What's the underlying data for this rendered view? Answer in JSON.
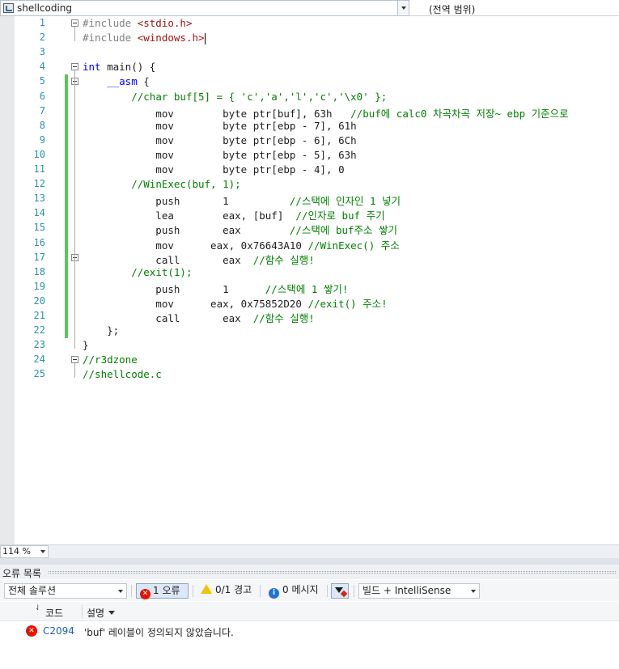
{
  "navbar": {
    "project": "shellcoding",
    "scope": "(전역 범위)"
  },
  "editor": {
    "lines": [
      {
        "n": "1",
        "html": "<span class=\"pp\">#include </span><span class=\"str\">&lt;stdio.h&gt;</span>"
      },
      {
        "n": "2",
        "html": "<span class=\"pp\">#include </span><span class=\"str\">&lt;windows.h&gt;</span><span class=\"cursor\"></span>"
      },
      {
        "n": "3",
        "html": ""
      },
      {
        "n": "4",
        "html": "<span class=\"kw\">int</span> main() {"
      },
      {
        "n": "5",
        "html": "    <span class=\"kw\">__asm</span> {"
      },
      {
        "n": "6",
        "html": "        <span class=\"cm\">//char buf[5] = { 'c','a','l','c','\\x0' };</span>"
      },
      {
        "n": "7",
        "html": "            mov        byte ptr[buf], 63h   <span class=\"cm\">//buf에 calc0 차곡차곡 저장~ ebp 기준으로</span>"
      },
      {
        "n": "8",
        "html": "            mov        byte ptr[ebp - 7], 61h"
      },
      {
        "n": "9",
        "html": "            mov        byte ptr[ebp - 6], 6Ch"
      },
      {
        "n": "10",
        "html": "            mov        byte ptr[ebp - 5], 63h"
      },
      {
        "n": "11",
        "html": "            mov        byte ptr[ebp - 4], 0"
      },
      {
        "n": "12",
        "html": "        <span class=\"cm\">//WinExec(buf, 1);</span>"
      },
      {
        "n": "13",
        "html": "            push       1          <span class=\"cm\">//스택에 인자인 1 넣기</span>"
      },
      {
        "n": "14",
        "html": "            lea        eax, [buf]  <span class=\"cm\">//인자로 buf 주기</span>"
      },
      {
        "n": "15",
        "html": "            push       eax        <span class=\"cm\">//스택에 buf주소 쌓기</span>"
      },
      {
        "n": "16",
        "html": "            mov      eax, 0x76643A10 <span class=\"cm\">//WinExec() 주소</span>"
      },
      {
        "n": "17",
        "html": "            call       eax  <span class=\"cm\">//함수 실행!</span>"
      },
      {
        "n": "18",
        "html": "        <span class=\"cm\">//exit(1);</span>"
      },
      {
        "n": "19",
        "html": "            push       1      <span class=\"cm\">//스택에 1 쌓기!</span>"
      },
      {
        "n": "20",
        "html": "            mov      eax, 0x75852D20 <span class=\"cm\">//exit() 주소!</span>"
      },
      {
        "n": "21",
        "html": "            call       eax  <span class=\"cm\">//함수 실행!</span>"
      },
      {
        "n": "22",
        "html": "    };"
      },
      {
        "n": "23",
        "html": "}"
      },
      {
        "n": "24",
        "html": "<span class=\"cm\">//r3dzone</span>"
      },
      {
        "n": "25",
        "html": "<span class=\"cm\">//shellcode.c</span>"
      }
    ]
  },
  "zoom": {
    "value": "114 %"
  },
  "error_list": {
    "title": "오류 목록",
    "scope": "전체 솔루션",
    "errors_label": "1 오류",
    "warnings_label": "0/1 경고",
    "messages_label": "0 메시지",
    "build_filter": "빌드 + IntelliSense",
    "col_code": "코드",
    "col_desc": "설명",
    "rows": [
      {
        "code": "C2094",
        "desc": "'buf' 레이블이 정의되지 않았습니다."
      }
    ]
  },
  "colors": {
    "keyword": "#0000ff",
    "comment": "#008000",
    "string": "#a31515",
    "line_number": "#2b91af",
    "change_bar": "#57c957"
  }
}
